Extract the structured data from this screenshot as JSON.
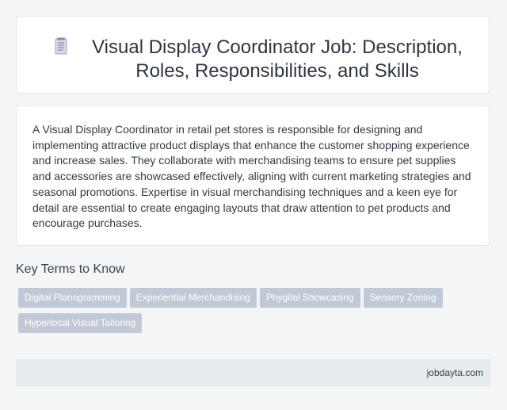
{
  "header": {
    "icon": "document-icon",
    "title": "Visual Display Coordinator Job: Description, Roles, Responsibilities, and Skills"
  },
  "description": {
    "text": "A Visual Display Coordinator in retail pet stores is responsible for designing and implementing attractive product displays that enhance the customer shopping experience and increase sales. They collaborate with merchandising teams to ensure pet supplies and accessories are showcased effectively, aligning with current marketing strategies and seasonal promotions. Expertise in visual merchandising techniques and a keen eye for detail are essential to create engaging layouts that draw attention to pet products and encourage purchases."
  },
  "key_terms": {
    "heading": "Key Terms to Know",
    "items": [
      "Digital Planogramming",
      "Experiential Merchandising",
      "Phygital Showcasing",
      "Sensory Zoning",
      "Hyperlocal Visual Tailoring"
    ]
  },
  "footer": {
    "site": "jobdayta.com"
  },
  "colors": {
    "background": "#f3f5f7",
    "tag": "#c2c9d6",
    "footer": "#e6ecee"
  }
}
